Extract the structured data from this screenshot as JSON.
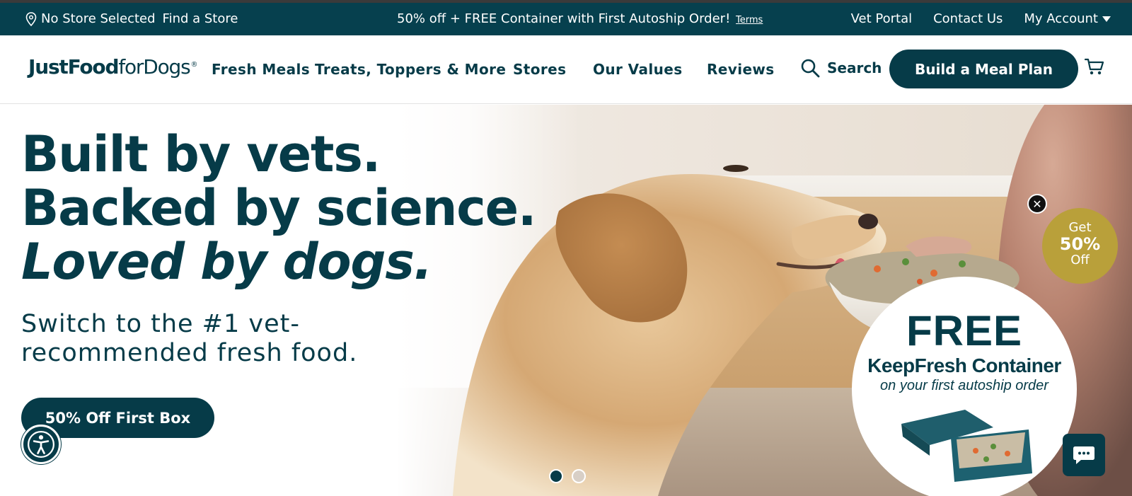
{
  "announcement": {
    "store_status": "No Store Selected",
    "find_store": "Find a Store",
    "promo": "50% off + FREE Container with First Autoship Order!",
    "terms": "Terms",
    "links": [
      "Vet Portal",
      "Contact Us",
      "My Account"
    ]
  },
  "header": {
    "logo": {
      "bold": "JustFood",
      "light": "forDogs",
      "mark": "®"
    },
    "nav": [
      "Fresh Meals",
      "Treats, Toppers & More",
      "Stores",
      "Our Values",
      "Reviews"
    ],
    "search_label": "Search",
    "cta": "Build a Meal Plan"
  },
  "hero": {
    "headline": [
      "Built by vets.",
      "Backed by science.",
      "Loved by dogs."
    ],
    "subtext": "Switch to the #1 vet-recommended fresh food.",
    "button": "50% Off First Box",
    "carousel": {
      "slides": 2,
      "active": 1
    }
  },
  "popup": {
    "close": "✕",
    "discount": {
      "line1": "Get",
      "line2": "50%",
      "line3": "Off"
    },
    "free": {
      "title": "FREE",
      "subtitle": "KeepFresh Container",
      "note": "on your first autoship order"
    }
  },
  "colors": {
    "brand": "#063b48",
    "gold": "#b9a03a",
    "white": "#ffffff"
  },
  "icons": [
    "location-pin-icon",
    "caret-down-icon",
    "search-icon",
    "cart-icon",
    "accessibility-icon",
    "chat-icon",
    "close-icon"
  ]
}
